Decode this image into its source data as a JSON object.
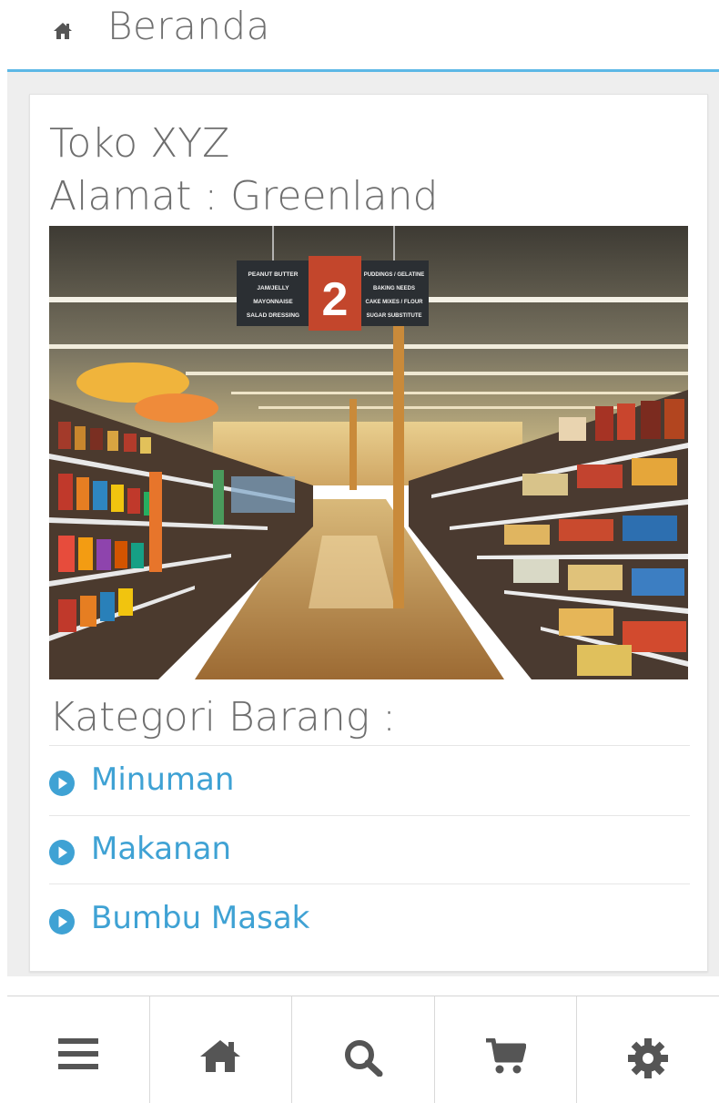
{
  "header": {
    "title": "Beranda",
    "icon": "home-icon"
  },
  "store": {
    "name": "Toko XYZ",
    "address": "Alamat : Greenland",
    "photo": "supermarket-aisle-photo"
  },
  "photo_sign": {
    "aisle_number": "2",
    "left_lines": [
      "PEANUT BUTTER",
      "JAM/JELLY",
      "MAYONNAISE",
      "SALAD DRESSING"
    ],
    "right_lines": [
      "PUDDINGS / GELATINE",
      "BAKING NEEDS",
      "CAKE MIXES / FLOUR",
      "SUGAR SUBSTITUTE"
    ]
  },
  "categories": {
    "title": "Kategori Barang :",
    "items": [
      {
        "label": "Minuman",
        "icon": "play-circle-icon"
      },
      {
        "label": "Makanan",
        "icon": "play-circle-icon"
      },
      {
        "label": "Bumbu Masak",
        "icon": "play-circle-icon"
      }
    ]
  },
  "bottom_nav": [
    {
      "icon": "menu-icon"
    },
    {
      "icon": "home-icon"
    },
    {
      "icon": "search-icon"
    },
    {
      "icon": "cart-icon"
    },
    {
      "icon": "gear-icon"
    }
  ],
  "colors": {
    "accent": "#5cb8e6",
    "link": "#3fa2d4",
    "text": "#6e6e6e",
    "icon": "#555555"
  }
}
